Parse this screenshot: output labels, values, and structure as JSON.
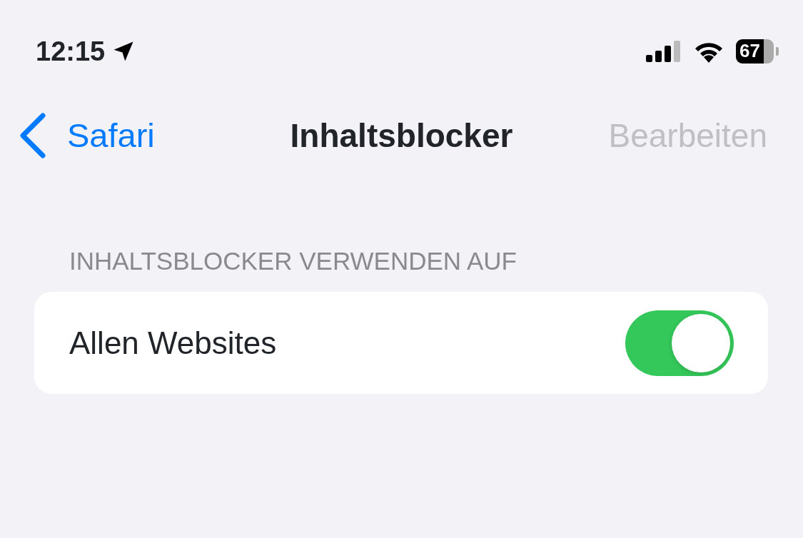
{
  "status_bar": {
    "time": "12:15",
    "battery": "67"
  },
  "nav_bar": {
    "back": "Safari",
    "title": "Inhaltsblocker",
    "edit": {
      "label": "Bearbeiten",
      "disabled": true
    }
  },
  "section": {
    "header": "INHALTSBLOCKER VERWENDEN AUF",
    "rows": [
      {
        "label": "Allen Websites",
        "on": true
      }
    ]
  }
}
